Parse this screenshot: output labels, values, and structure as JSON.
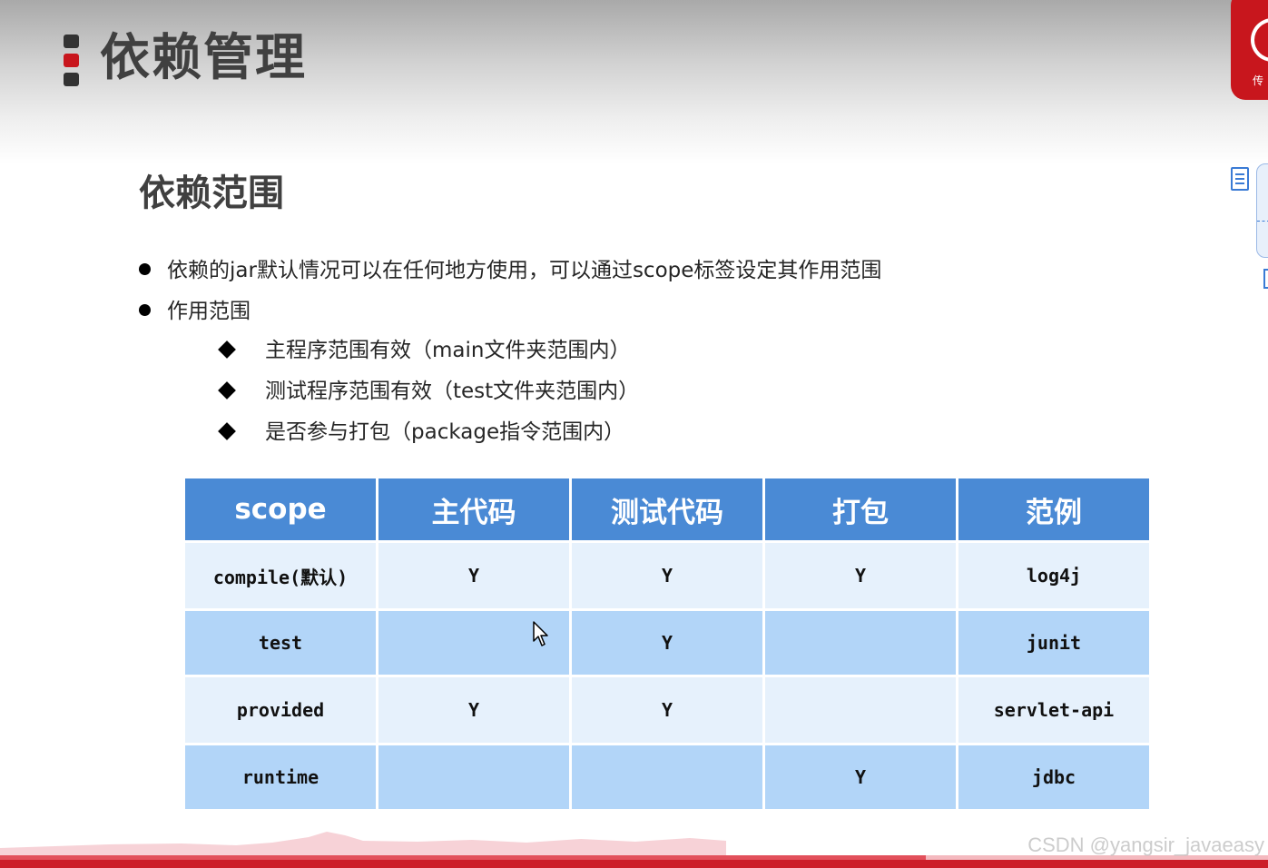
{
  "header": {
    "title": "依赖管理"
  },
  "brand": {
    "logo_text": "传"
  },
  "section": {
    "title": "依赖范围"
  },
  "bullets": [
    {
      "text": "依赖的jar默认情况可以在任何地方使用，可以通过scope标签设定其作用范围"
    },
    {
      "text": "作用范围"
    }
  ],
  "sub_bullets": [
    {
      "text": "主程序范围有效（main文件夹范围内）"
    },
    {
      "text": "测试程序范围有效（test文件夹范围内）"
    },
    {
      "text": "是否参与打包（package指令范围内）"
    }
  ],
  "table": {
    "headers": [
      "scope",
      "主代码",
      "测试代码",
      "打包",
      "范例"
    ],
    "rows": [
      [
        "compile(默认)",
        "Y",
        "Y",
        "Y",
        "log4j"
      ],
      [
        "test",
        "",
        "Y",
        "",
        "junit"
      ],
      [
        "provided",
        "Y",
        "Y",
        "",
        "servlet-api"
      ],
      [
        "runtime",
        "",
        "",
        "Y",
        "jdbc"
      ]
    ]
  },
  "player": {
    "progress": 0.73
  },
  "watermark": "CSDN @yangsir_javaeasy",
  "colors": {
    "accent_red": "#c8161d",
    "table_header": "#4a8ad5",
    "row_light": "#e6f1fc",
    "row_dark": "#b2d5f8"
  },
  "icons": [
    "title-marker-icon",
    "logo-icon",
    "note-icon",
    "cursor-icon"
  ]
}
